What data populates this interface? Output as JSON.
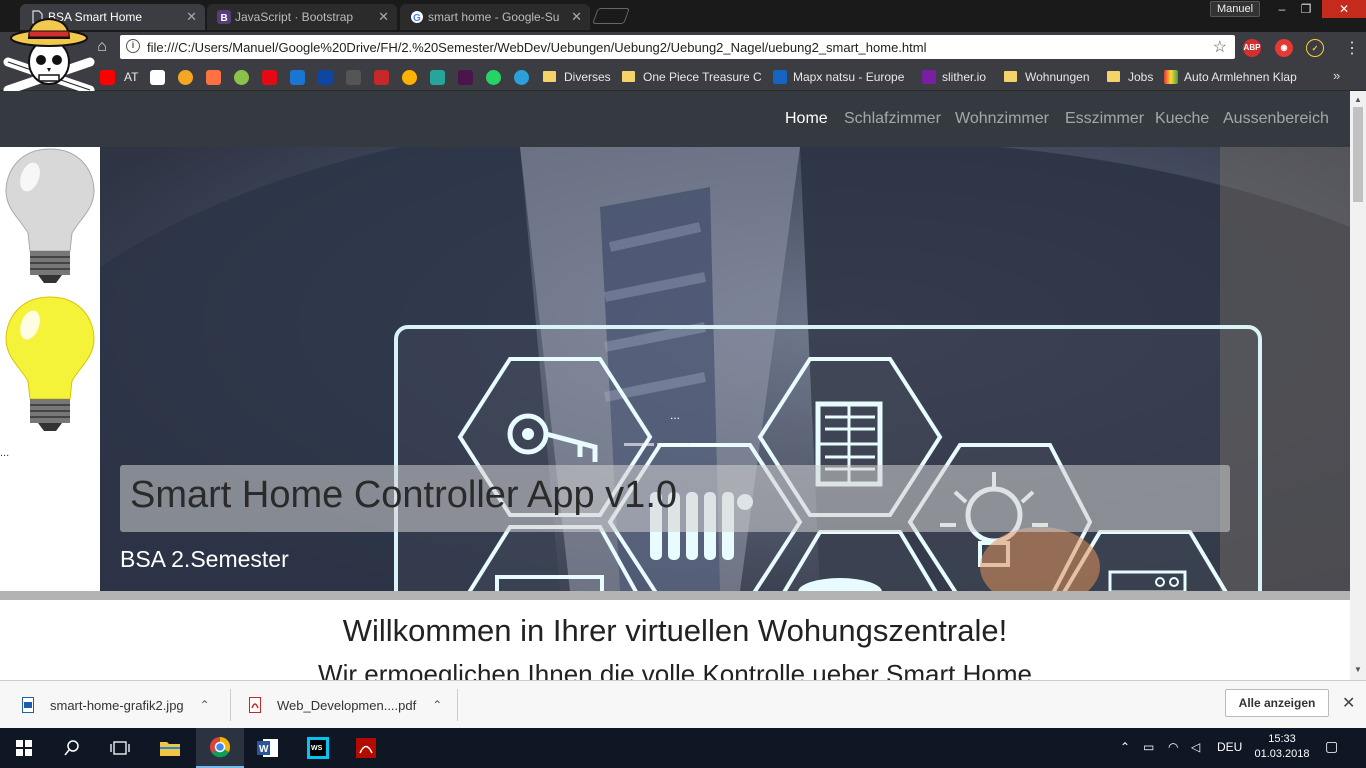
{
  "browser": {
    "tabs": [
      {
        "title": "BSA Smart Home",
        "favicon": "document-icon",
        "active": true
      },
      {
        "title": "JavaScript · Bootstrap",
        "favicon": "bootstrap-icon",
        "active": false
      },
      {
        "title": "smart home - Google-Su",
        "favicon": "google-icon",
        "active": false
      }
    ],
    "profile": "Manuel",
    "url": "file:///C:/Users/Manuel/Google%20Drive/FH/2.%20Semester/WebDev/Uebungen/Uebung2/Uebung2_Nagel/uebung2_smart_home.html",
    "extensions": [
      "abp-icon",
      "adblock-icon",
      "ext-check-icon"
    ],
    "ext_labels": {
      "abp": "ABP"
    },
    "bookmarks": {
      "at": "AT",
      "diverses": "Diverses",
      "one_piece": "One Piece Treasure C",
      "mapx": "Mapx natsu - Europe",
      "slither": "slither.io",
      "wohnungen": "Wohnungen",
      "jobs": "Jobs",
      "auto": "Auto Armlehnen Klap"
    }
  },
  "site": {
    "nav": {
      "home": "Home",
      "schlafzimmer": "Schlafzimmer",
      "wohnzimmer": "Wohnzimmer",
      "esszimmer": "Esszimmer",
      "kueche": "Kueche",
      "aussenbereich": "Aussenbereich"
    },
    "carousel": {
      "dots": "...",
      "title": "Smart Home Controller App v1.0",
      "subtitle": "BSA 2.Semester"
    },
    "ellipsis": "...",
    "welcome": "Willkommen in Ihrer virtuellen Wohungszentrale!",
    "sub_welcome": "Wir ermoeglichen Ihnen die volle Kontrolle ueber Smart Home"
  },
  "downloads": {
    "items": [
      {
        "name": "smart-home-grafik2.jpg",
        "icon": "image-file-icon"
      },
      {
        "name": "Web_Developmen....pdf",
        "icon": "pdf-file-icon"
      }
    ],
    "show_all": "Alle anzeigen"
  },
  "taskbar": {
    "language": "DEU",
    "time": "15:33",
    "date": "01.03.2018"
  },
  "colors": {
    "navbar": "#343a40",
    "chrome_toolbar": "#3b3d42",
    "taskbar": "#0f1724"
  }
}
